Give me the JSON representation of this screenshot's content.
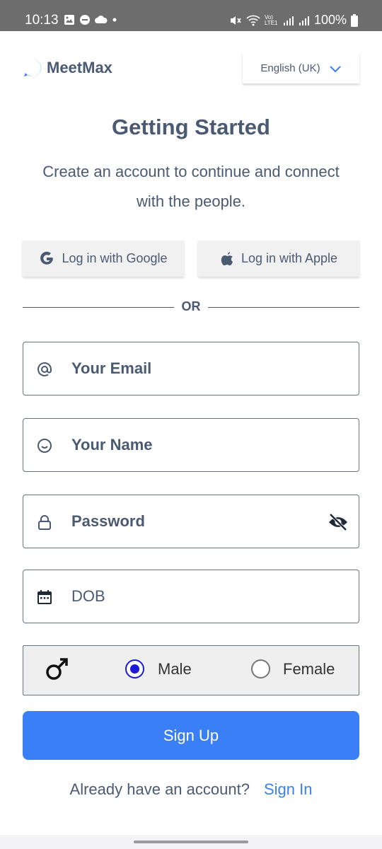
{
  "status_bar": {
    "time": "10:13",
    "battery": "100%",
    "icons": [
      "gallery-icon",
      "dnd-icon",
      "cloud-icon",
      "dot-icon",
      "mute-icon",
      "wifi-icon",
      "volte-icon",
      "signal-icon",
      "signal-icon",
      "battery-icon"
    ],
    "volte_label": "Vo) LTE1"
  },
  "header": {
    "brand": "MeetMax",
    "language": "English (UK)"
  },
  "intro": {
    "title": "Getting Started",
    "subtitle": "Create an account to continue and connect with the people."
  },
  "social": {
    "google_label": "Log in with Google",
    "apple_label": "Log in with Apple"
  },
  "divider": {
    "label": "OR"
  },
  "form": {
    "email_placeholder": "Your Email",
    "name_placeholder": "Your Name",
    "password_placeholder": "Password",
    "dob_placeholder": "DOB",
    "gender": {
      "options": [
        "Male",
        "Female"
      ],
      "selected": "Male"
    }
  },
  "actions": {
    "signup_label": "Sign Up",
    "have_account_text": "Already have an account?",
    "signin_label": "Sign In"
  },
  "colors": {
    "primary": "#3a7ff5",
    "text": "#4b5a73",
    "radio_selected": "#1a1ad8",
    "status_bar": "#6d6d6d"
  }
}
